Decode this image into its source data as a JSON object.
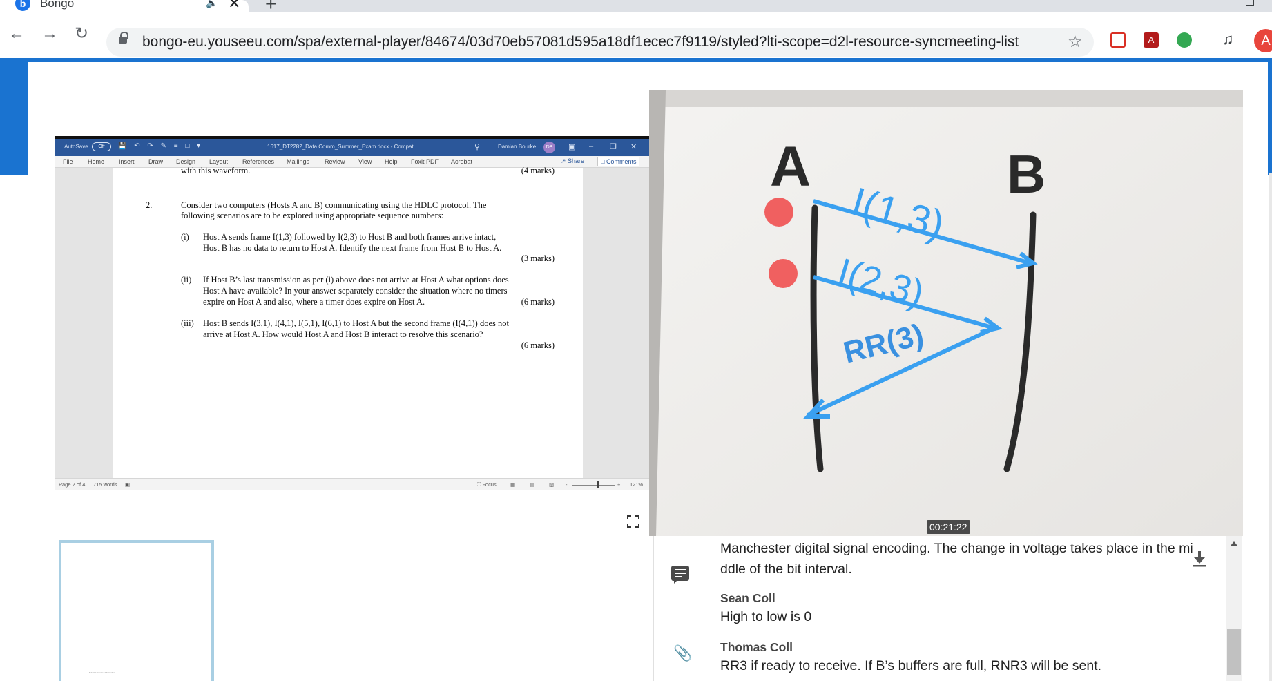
{
  "browser": {
    "tab": {
      "favicon": "b",
      "title": "Bongo"
    },
    "url": "bongo-eu.youseeu.com/spa/external-player/84674/03d70eb57081d595a18df1ecec7f9119/styled?lti-scope=d2l-resource-syncmeeting-list",
    "avatar": "A",
    "pdf_label": "A"
  },
  "word": {
    "autosave": "AutoSave",
    "autosave_state": "Off",
    "doc_name": "1617_DT2282_Data Comm_Summer_Exam.docx  -  Compati...",
    "user": "Damian Bourke",
    "user_initials": "DB",
    "menu": [
      "File",
      "Home",
      "Insert",
      "Draw",
      "Design",
      "Layout",
      "References",
      "Mailings",
      "Review",
      "View",
      "Help",
      "Foxit PDF",
      "Acrobat"
    ],
    "share_label": "Share",
    "comments_label": "Comments",
    "doc": {
      "prev_line": "with this waveform.",
      "prev_marks": "(4 marks)",
      "q_num": "2.",
      "q_line1": "Consider two computers (Hosts A and B) communicating using the HDLC protocol.  The",
      "q_line2": "following scenarios are to be explored using appropriate sequence numbers:",
      "p1_num": "(i)",
      "p1_line1": "Host A sends frame I(1,3) followed by I(2,3) to Host B and both frames arrive intact,",
      "p1_line2": "Host B has no data to return to Host A.  Identify the next frame from Host B to Host A.",
      "p1_marks": "(3 marks)",
      "p2_num": "(ii)",
      "p2_line1": "If Host B’s last transmission as per (i) above does not arrive at Host A what options does",
      "p2_line2": "Host A have available? In your answer separately consider the situation where no timers",
      "p2_line3": "expire on Host A and also, where a timer does expire on Host A.",
      "p2_marks": "(6 marks)",
      "p3_num": "(iii)",
      "p3_line1": "Host B sends I(3,1), I(4,1), I(5,1), I(6,1) to Host A but the second frame (I(4,1)) does not",
      "p3_line2": "arrive at Host A.  How would Host A and Host B interact to resolve this scenario?",
      "p3_marks": "(6 marks)"
    },
    "status": {
      "page": "Page 2 of 4",
      "words": "715 words",
      "focus": "Focus",
      "zoom": "121%"
    }
  },
  "video": {
    "timestamp": "00:21:22",
    "whiteboard": {
      "host_a": "A",
      "host_b": "B",
      "frame1": "I(1,3)",
      "frame2": "I(2,3)",
      "reply": "RR(3)"
    }
  },
  "thumbnail": {
    "caption": "Tutorial Transfer Information..."
  },
  "chat": {
    "messages": [
      {
        "name": "",
        "text_line1": "Manchester digital signal encoding. The change in voltage takes place in the mi",
        "text_line2": "ddle of the bit interval."
      },
      {
        "name": "Sean Coll",
        "text": "High to low is 0"
      },
      {
        "name": "Thomas Coll",
        "text": "RR3 if ready to receive. If B’s buffers are full, RNR3 will be sent."
      }
    ]
  },
  "icons": {
    "back": "arrow-left-icon",
    "forward": "arrow-right-icon",
    "reload": "reload-icon",
    "bookmark": "star-icon",
    "fullscreen": "fullscreen-icon",
    "chat": "chat-bubble-icon",
    "attach": "paperclip-icon",
    "download": "download-icon"
  },
  "colors": {
    "brand_blue": "#1a73d0",
    "word_blue": "#2b579a",
    "marker_blue": "#3aa0f0",
    "marker_red": "#f06060",
    "thumb_border": "#a9cfe3"
  }
}
